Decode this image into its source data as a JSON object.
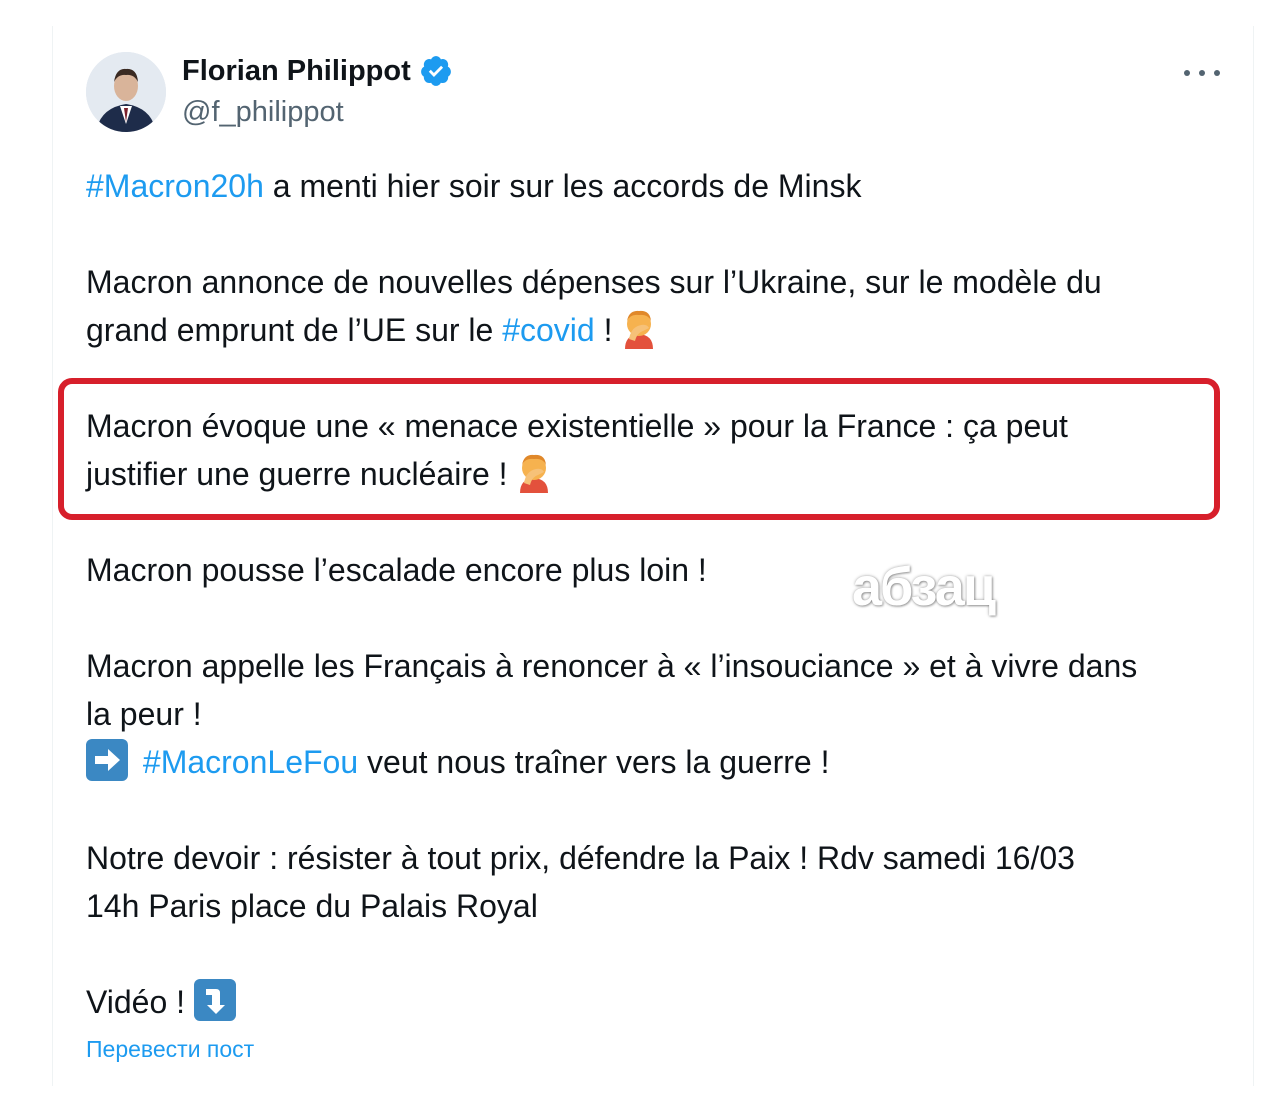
{
  "author": {
    "name": "Florian Philippot",
    "handle": "@f_philippot"
  },
  "paragraphs": {
    "p1_tag": "#Macron20h",
    "p1_text": " a menti hier soir sur les accords de Minsk",
    "p2_line1": "Macron annonce de nouvelles dépenses sur l’Ukraine, sur le modèle du",
    "p2_line2_pre": "grand emprunt de l’UE sur le ",
    "p2_tag": "#covid",
    "p2_line2_post": " ! ",
    "p3_line1": "Macron évoque une « menace existentielle » pour la France : ça peut",
    "p3_line2": "justifier une guerre nucléaire ! ",
    "p4": "Macron pousse l’escalade encore plus loin !",
    "p5_line1": "Macron appelle les Français à renoncer à « l’insouciance » et à vivre dans",
    "p5_line2": "la peur !",
    "p5_line3_tag": "#MacronLeFou",
    "p5_line3_text": " veut nous traîner vers la guerre !",
    "p6_line1": "Notre devoir : résister à tout prix, défendre la Paix ! Rdv samedi 16/03",
    "p6_line2": "14h Paris place du Palais Royal",
    "p7": "Vidéo ! "
  },
  "translate_link": "Перевести пост",
  "watermark": "абзац",
  "colors": {
    "hashtag": "#1d9bf0",
    "highlight_border": "#d71f2b",
    "verified": "#1d9bf0"
  },
  "icons": [
    "verified-badge-icon",
    "more-options-icon",
    "facepalm-emoji-icon",
    "arrow-right-emoji-icon",
    "arrow-down-emoji-icon"
  ]
}
